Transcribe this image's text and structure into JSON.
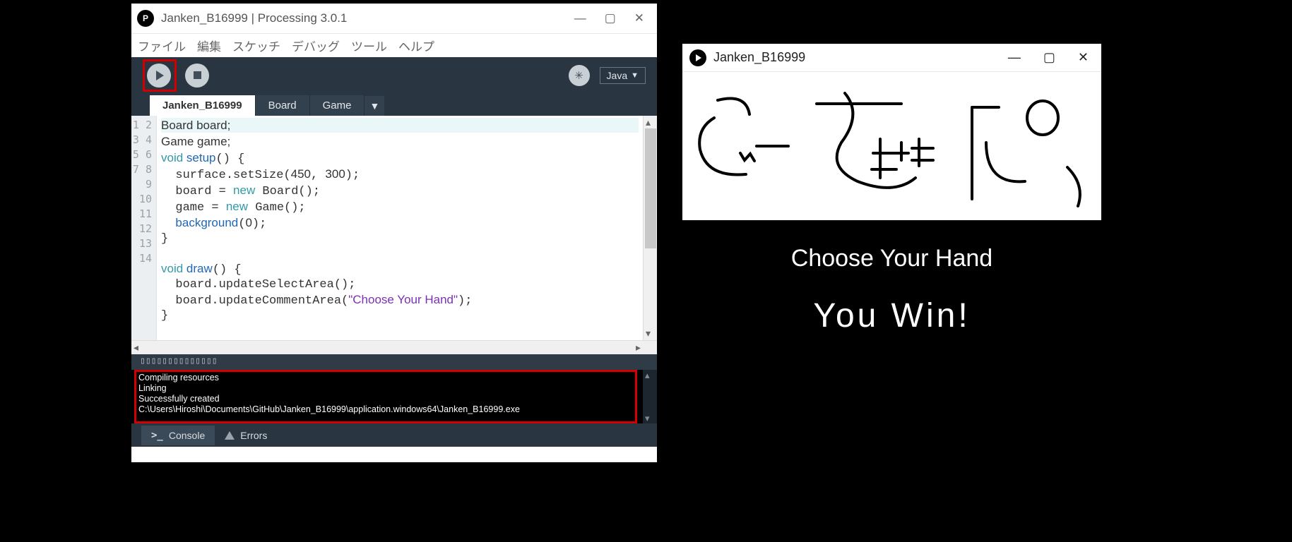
{
  "ide": {
    "title": "Janken_B16999 | Processing 3.0.1",
    "window_controls": {
      "min": "—",
      "max": "▢",
      "close": "✕"
    },
    "menu": [
      "ファイル",
      "編集",
      "スケッチ",
      "デバッグ",
      "ツール",
      "ヘルプ"
    ],
    "toolbar": {
      "lang": "Java",
      "debug_glyph": "✳"
    },
    "tabs": [
      "Janken_B16999",
      "Board",
      "Game"
    ],
    "tab_menu_glyph": "▼",
    "code_lines": [
      {
        "n": "1",
        "tokens": [
          {
            "t": "Board board;",
            "c": "type"
          }
        ],
        "hl": true
      },
      {
        "n": "2",
        "tokens": [
          {
            "t": "Game game;",
            "c": "type"
          }
        ]
      },
      {
        "n": "3",
        "tokens": [
          {
            "t": "void ",
            "c": "kw"
          },
          {
            "t": "setup",
            "c": "fn"
          },
          {
            "t": "() {",
            "c": ""
          }
        ]
      },
      {
        "n": "4",
        "tokens": [
          {
            "t": "  surface.setSize(",
            "c": ""
          },
          {
            "t": "450",
            "c": "num"
          },
          {
            "t": ", ",
            "c": ""
          },
          {
            "t": "300",
            "c": "num"
          },
          {
            "t": ");",
            "c": ""
          }
        ]
      },
      {
        "n": "5",
        "tokens": [
          {
            "t": "  board = ",
            "c": ""
          },
          {
            "t": "new",
            "c": "kw"
          },
          {
            "t": " Board();",
            "c": ""
          }
        ]
      },
      {
        "n": "6",
        "tokens": [
          {
            "t": "  game = ",
            "c": ""
          },
          {
            "t": "new",
            "c": "kw"
          },
          {
            "t": " Game();",
            "c": ""
          }
        ]
      },
      {
        "n": "7",
        "tokens": [
          {
            "t": "  ",
            "c": ""
          },
          {
            "t": "background",
            "c": "fn"
          },
          {
            "t": "(",
            "c": ""
          },
          {
            "t": "0",
            "c": "num"
          },
          {
            "t": ");",
            "c": ""
          }
        ]
      },
      {
        "n": "8",
        "tokens": [
          {
            "t": "}",
            "c": ""
          }
        ]
      },
      {
        "n": "9",
        "tokens": [
          {
            "t": "",
            "c": ""
          }
        ]
      },
      {
        "n": "10",
        "tokens": [
          {
            "t": "void ",
            "c": "kw"
          },
          {
            "t": "draw",
            "c": "fn"
          },
          {
            "t": "() {",
            "c": ""
          }
        ]
      },
      {
        "n": "11",
        "tokens": [
          {
            "t": "  board.updateSelectArea();",
            "c": ""
          }
        ]
      },
      {
        "n": "12",
        "tokens": [
          {
            "t": "  board.updateCommentArea(",
            "c": ""
          },
          {
            "t": "\"Choose Your Hand\"",
            "c": "str"
          },
          {
            "t": ");",
            "c": ""
          }
        ]
      },
      {
        "n": "13",
        "tokens": [
          {
            "t": "}",
            "c": ""
          }
        ]
      },
      {
        "n": "14",
        "tokens": [
          {
            "t": "",
            "c": ""
          }
        ]
      }
    ],
    "console_header": "▯▯▯▯▯▯▯▯▯▯▯▯▯▯",
    "console_lines": [
      "Compiling resources",
      "Linking",
      "Successfully created",
      "C:\\Users\\Hiroshi\\Documents\\GitHub\\Janken_B16999\\application.windows64\\Janken_B16999.exe"
    ],
    "status_tabs": {
      "console": "Console",
      "errors": "Errors"
    }
  },
  "sketch": {
    "title": "Janken_B16999",
    "window_controls": {
      "min": "—",
      "max": "▢",
      "close": "✕"
    },
    "line1": "Choose Your Hand",
    "line2": "You Win!"
  }
}
